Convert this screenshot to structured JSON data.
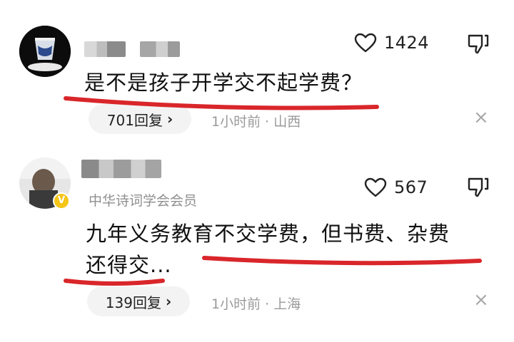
{
  "comments": [
    {
      "like_count": "1424",
      "text_lines": [
        "是不是孩子开学交不起学费？"
      ],
      "reply_count_label": "701回复",
      "reply_chevron": "›",
      "meta": "1小时前 · 山西",
      "close_symbol": "×"
    },
    {
      "user_title": "中华诗词学会会员",
      "verified_badge": "V",
      "like_count": "567",
      "text_lines": [
        "九年义务教育不交学费，但书费、杂费",
        "还得交..."
      ],
      "reply_count_label": "139回复",
      "reply_chevron": "›",
      "meta": "1小时前 · 上海",
      "close_symbol": "×"
    }
  ],
  "colors": {
    "underline_red": "#d9262a",
    "meta_gray": "#9a9a9a",
    "badge_gold": "#f5c518"
  },
  "icons": [
    "heart-icon",
    "dislike-icon",
    "close-icon",
    "verified-icon",
    "chevron-right-icon"
  ]
}
